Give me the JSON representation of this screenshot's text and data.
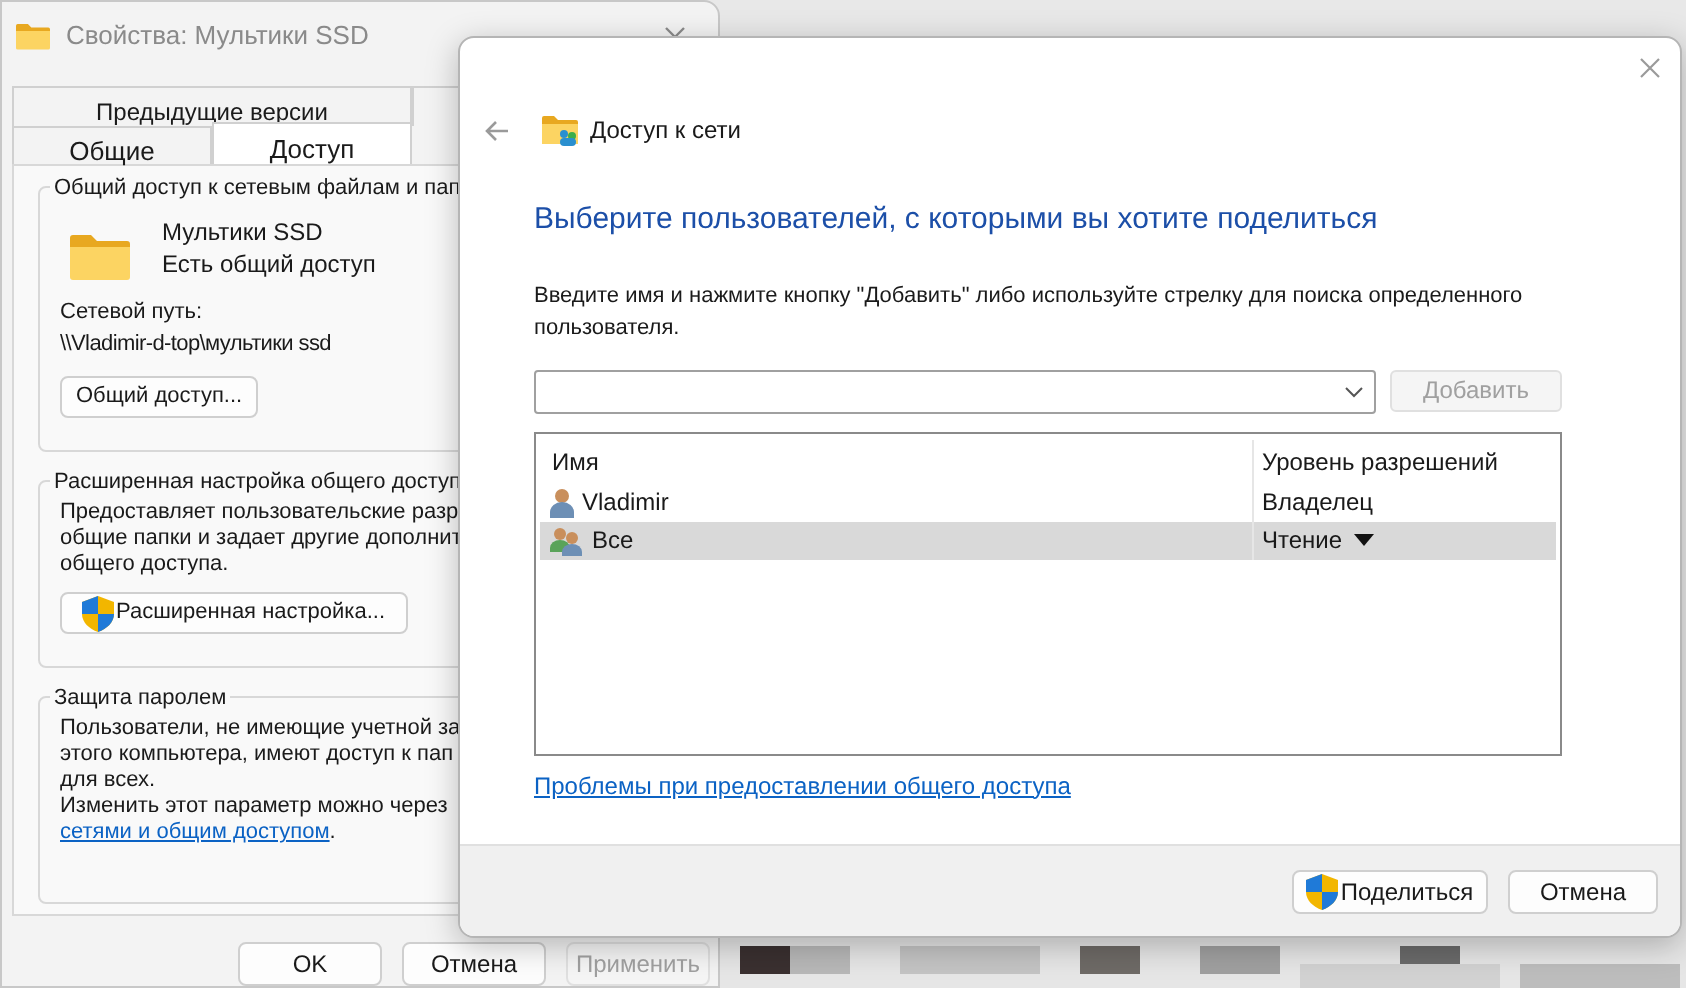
{
  "properties_window": {
    "title": "Свойства: Мультики SSD",
    "tabs_back": [
      {
        "label": "Предыдущие версии",
        "selected": false
      }
    ],
    "tabs_front": [
      {
        "label": "Общие",
        "selected": false
      },
      {
        "label": "Доступ",
        "selected": true
      }
    ],
    "network_group": {
      "title": "Общий доступ к сетевым файлам и пап",
      "folder_name": "Мультики SSD",
      "folder_status": "Есть общий доступ",
      "path_label": "Сетевой путь:",
      "path": "\\\\Vladimir-d-top\\мультики ssd",
      "button": "Общий доступ..."
    },
    "advanced_group": {
      "title": "Расширенная настройка общего доступ",
      "lines": [
        "Предоставляет пользовательские разр",
        "общие папки и задает другие дополнит",
        "общего доступа."
      ],
      "button": "Расширенная настройка..."
    },
    "password_group": {
      "title": "Защита паролем",
      "lines": [
        "Пользователи, не имеющие учетной за",
        "этого компьютера, имеют доступ к пап",
        "для всех.",
        "Изменить этот параметр можно через"
      ],
      "link": "сетями и общим доступом",
      "after_link": "."
    },
    "buttons": [
      {
        "label": "OK",
        "disabled": false
      },
      {
        "label": "Отмена",
        "disabled": false
      },
      {
        "label": "Применить",
        "disabled": true
      }
    ]
  },
  "share_dialog": {
    "title": "Доступ к сети",
    "heading": "Выберите пользователей, с которыми вы хотите поделиться",
    "instruction": "Введите имя и нажмите кнопку \"Добавить\" либо используйте стрелку для поиска определенного пользователя.",
    "add_button": {
      "label": "Добавить",
      "disabled": true
    },
    "table": {
      "columns": [
        "Имя",
        "Уровень разрешений"
      ],
      "rows": [
        {
          "kind": "user",
          "name": "Vladimir",
          "permission": "Владелец",
          "selected": false,
          "dropdown": false
        },
        {
          "kind": "group",
          "name": "Все",
          "permission": "Чтение",
          "selected": true,
          "dropdown": true
        }
      ]
    },
    "link": "Проблемы при предоставлении общего доступа",
    "buttons": [
      {
        "label": "Поделиться",
        "shield": true
      },
      {
        "label": "Отмена",
        "shield": false
      }
    ]
  }
}
